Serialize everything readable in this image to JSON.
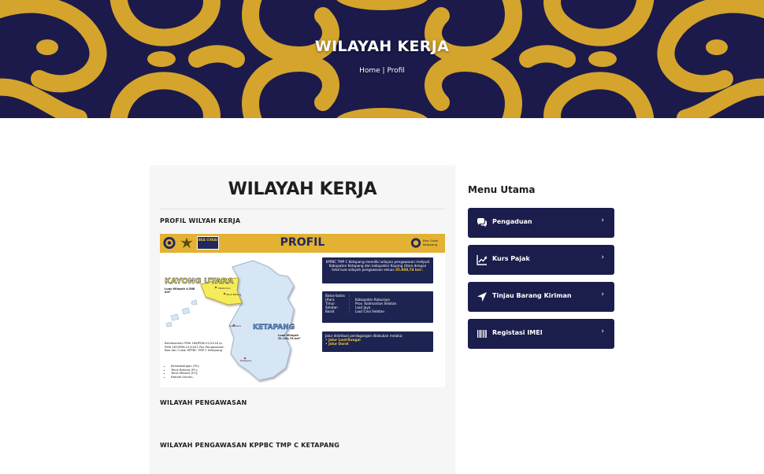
{
  "hero": {
    "title": "WILAYAH KERJA",
    "breadcrumb": {
      "home": "Home",
      "separator": " | ",
      "current": "Profil"
    }
  },
  "content": {
    "title": "WILAYAH KERJA",
    "sections": [
      "PROFIL WILYAH KERJA",
      "WILAYAH PENGAWASAN",
      "WILAYAH PENGAWASAN KPPBC TMP C KETAPANG"
    ],
    "profil_image": {
      "banner_title": "PROFIL",
      "logo_left_text": "BEA CUKAI",
      "logo_right_text": "Bea Cukai Ketapang",
      "region_kayong": "KAYONG UTARA",
      "region_kayong_area": "Luas Wilayah 4.568 km²",
      "region_ketapang": "KETAPANG",
      "region_ketapang_area": "Luas Wilayah 31.240,74 km²",
      "town_labels": [
        "Pelabuhan",
        "Teluk Batang",
        "Sukadana",
        "Ketapang",
        "Kendawangan"
      ],
      "basis_text": "Berdasarkan PMK.166/PMK.01/2016 jo. PMK.183/PMK.01/2022 Pos Pengawasan Bea dan Cukai KPPBC TMP C Ketapang",
      "pos_list": [
        "Kendawangan (PL);",
        "Teluk Batang (PL);",
        "Teluk Melano (PL);",
        "Bahadi Usman."
      ],
      "info1_text": "KPPBC TMP C Ketapang memiliki wilayan pengawasan meliputi Kabupaten Ketapang dan kabupaten Kayong Utara dengan total luas wilayah pengawasan seluas",
      "info1_highlight": "35.808,74 km².",
      "info2_title": "Batas-batas",
      "info2_rows": [
        {
          "k": "Utara",
          "v": "Kabupaten Kuburaya"
        },
        {
          "k": "Timur",
          "v": "Prov. Kalimantan Selatan"
        },
        {
          "k": "Selatan",
          "v": "Laut Jaya"
        },
        {
          "k": "Barat",
          "v": "Laut Cina Selatan"
        }
      ],
      "info3_title": "Jalur distribusi perdagangan dilakukan melalui:",
      "info3_items": [
        "Jalur Laut/Sungai",
        "Jalur Darat"
      ]
    }
  },
  "sidebar": {
    "title": "Menu Utama",
    "items": [
      {
        "label": "Pengaduan",
        "icon": "comments-icon"
      },
      {
        "label": "Kurs Pajak",
        "icon": "chart-line-icon"
      },
      {
        "label": "Tinjau Barang Kiriman",
        "icon": "location-arrow-icon"
      },
      {
        "label": "Registasi IMEI",
        "icon": "barcode-icon"
      }
    ],
    "chevron": "›"
  },
  "colors": {
    "navy": "#1b1d4c",
    "gold": "#d4a42c",
    "banner_gold": "#e3b232",
    "hero_bg": "#1b1a4b"
  }
}
